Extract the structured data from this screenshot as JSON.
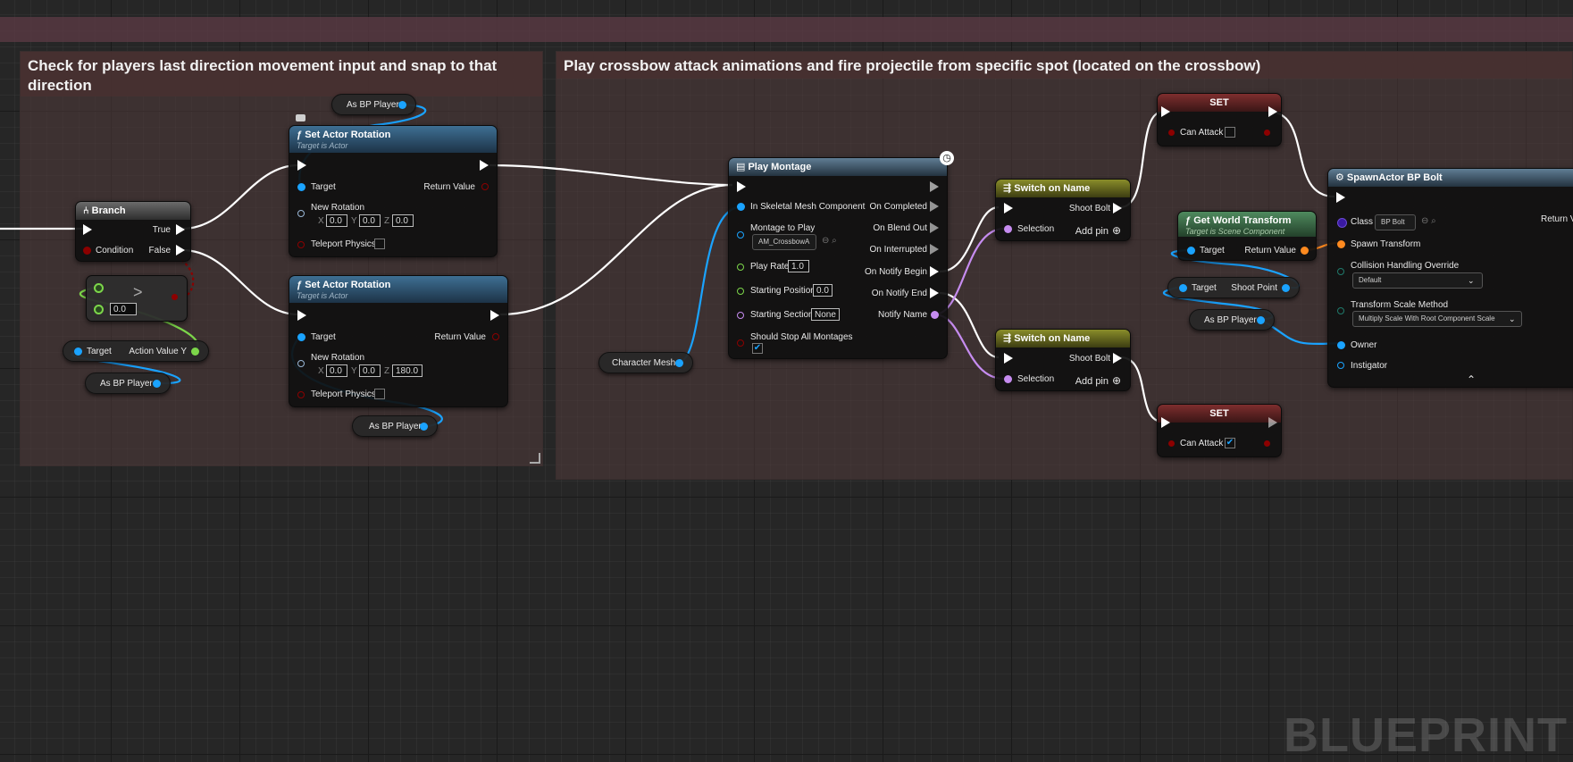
{
  "comments": {
    "left": "Check for players last direction movement input and snap to that direction",
    "right": "Play crossbow attack animations and fire projectile from specific spot (located on the crossbow)"
  },
  "branch": {
    "title": "Branch",
    "true": "True",
    "condition": "Condition",
    "false": "False"
  },
  "compare": {
    "op": ">",
    "value": "0.0"
  },
  "get_action": {
    "target": "Target",
    "output": "Action Value Y"
  },
  "as_bp_player": "As BP Player",
  "set_rot_1": {
    "title": "Set Actor Rotation",
    "subtitle": "Target is Actor",
    "target": "Target",
    "return": "Return Value",
    "new_rotation": "New Rotation",
    "x": "0.0",
    "y": "0.0",
    "z": "0.0",
    "teleport": "Teleport Physics"
  },
  "set_rot_2": {
    "title": "Set Actor Rotation",
    "subtitle": "Target is Actor",
    "target": "Target",
    "return": "Return Value",
    "new_rotation": "New Rotation",
    "x": "0.0",
    "y": "0.0",
    "z": "180.0",
    "teleport": "Teleport Physics"
  },
  "axis": {
    "x": "X",
    "y": "Y",
    "z": "Z"
  },
  "character_mesh": "Character Mesh",
  "play_montage": {
    "title": "Play Montage",
    "in_mesh": "In Skeletal Mesh Component",
    "montage": "Montage to Play",
    "montage_value": "AM_CrossbowA",
    "play_rate": "Play Rate",
    "play_rate_value": "1.0",
    "start_pos": "Starting Position",
    "start_pos_value": "0.0",
    "start_section": "Starting Section",
    "start_section_value": "None",
    "stop_all": "Should Stop All Montages",
    "on_completed": "On Completed",
    "on_blend_out": "On Blend Out",
    "on_interrupted": "On Interrupted",
    "on_notify_begin": "On Notify Begin",
    "on_notify_end": "On Notify End",
    "notify_name": "Notify Name"
  },
  "switch_1": {
    "title": "Switch on Name",
    "shoot_bolt": "Shoot Bolt",
    "selection": "Selection",
    "add_pin": "Add pin"
  },
  "switch_2": {
    "title": "Switch on Name",
    "shoot_bolt": "Shoot Bolt",
    "selection": "Selection",
    "add_pin": "Add pin"
  },
  "set_1": {
    "title": "SET",
    "var": "Can Attack"
  },
  "set_2": {
    "title": "SET",
    "var": "Can Attack"
  },
  "get_world": {
    "title": "Get World Transform",
    "subtitle": "Target is Scene Component",
    "target": "Target",
    "return": "Return Value"
  },
  "shoot_point": {
    "target": "Target",
    "output": "Shoot Point"
  },
  "spawn": {
    "title": "SpawnActor BP Bolt",
    "class": "Class",
    "class_value": "BP Bolt",
    "return": "Return Va",
    "spawn_transform": "Spawn Transform",
    "collision": "Collision Handling Override",
    "collision_value": "Default",
    "scale_method": "Transform Scale Method",
    "scale_value": "Multiply Scale With Root Component Scale",
    "owner": "Owner",
    "instigator": "Instigator"
  },
  "watermark": "BLUEPRINT",
  "colors": {
    "exec": "#ffffff",
    "object": "#1aa3ff",
    "bool": "#8c0000",
    "float": "#7cd64a",
    "name": "#c68cf0",
    "struct": "#ff8a1f"
  }
}
